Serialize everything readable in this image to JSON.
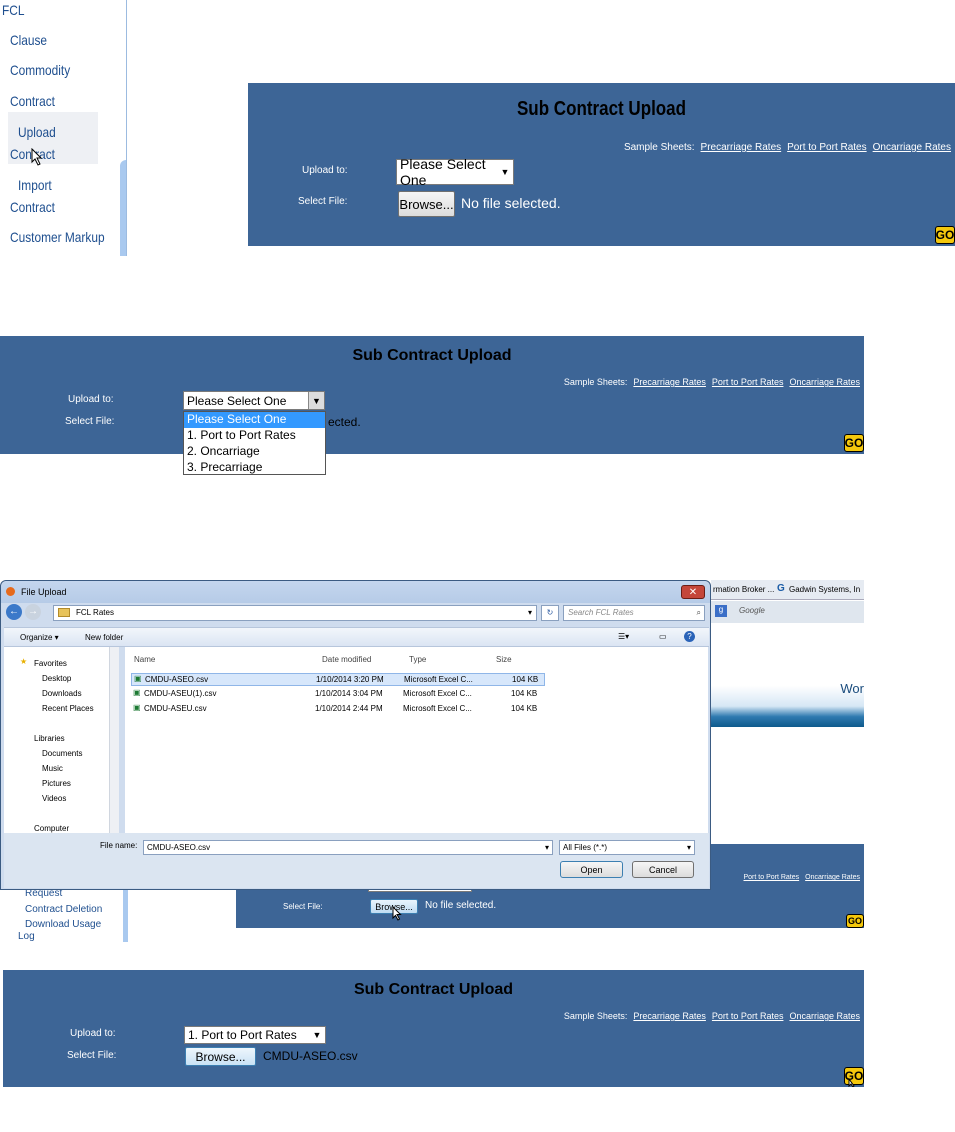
{
  "sidebar": {
    "root": "FCL",
    "items": [
      "Clause",
      "Commodity",
      "Contract"
    ],
    "upload_line1": "Upload",
    "upload_line2": "Contract",
    "import_line1": "Import",
    "import_line2": "Contract",
    "markup": "Customer Markup"
  },
  "form": {
    "title": "Sub Contract Upload",
    "sample_label": "Sample Sheets:",
    "links": [
      "Precarriage Rates",
      "Port to Port Rates",
      "Oncarriage Rates"
    ],
    "upload_label": "Upload to:",
    "file_label": "Select File:",
    "select_default": "Please Select One",
    "browse_label": "Browse...",
    "no_file": "No file selected.",
    "go": "GO",
    "options": [
      "Please Select One",
      "1. Port to Port Rates",
      "2. Oncarriage",
      "3. Precarriage"
    ],
    "ected_fragment": "ected.",
    "selected_option": "1. Port to Port Rates",
    "selected_file": "CMDU-ASEO.csv"
  },
  "dialog": {
    "title": "File Upload",
    "path": "FCL Rates",
    "search_placeholder": "Search FCL Rates",
    "organize": "Organize ▾",
    "new_folder": "New folder",
    "nav": {
      "favorites": "Favorites",
      "fav_items": [
        "Desktop",
        "Downloads",
        "Recent Places"
      ],
      "libraries": "Libraries",
      "lib_items": [
        "Documents",
        "Music",
        "Pictures",
        "Videos"
      ],
      "computer": "Computer"
    },
    "columns": [
      "Name",
      "Date modified",
      "Type",
      "Size"
    ],
    "files": [
      {
        "name": "CMDU-ASEO.csv",
        "date": "1/10/2014 3:20 PM",
        "type": "Microsoft Excel C...",
        "size": "104 KB"
      },
      {
        "name": "CMDU-ASEU(1).csv",
        "date": "1/10/2014 3:04 PM",
        "type": "Microsoft Excel C...",
        "size": "104 KB"
      },
      {
        "name": "CMDU-ASEU.csv",
        "date": "1/10/2014 2:44 PM",
        "type": "Microsoft Excel C...",
        "size": "104 KB"
      }
    ],
    "filename_label": "File name:",
    "filename_value": "CMDU-ASEO.csv",
    "filter": "All Files (*.*)",
    "open": "Open",
    "cancel": "Cancel"
  },
  "browser": {
    "tab1": "rmation Broker ...",
    "tab2": "Gadwin Systems, In",
    "search": "Google",
    "banner_text": "Wor"
  },
  "sidebar_lower": {
    "items": [
      "Request",
      "Contract Deletion",
      "Download Usage",
      "Log"
    ]
  },
  "panel3_select_partial": "1. Port to Port Rates"
}
